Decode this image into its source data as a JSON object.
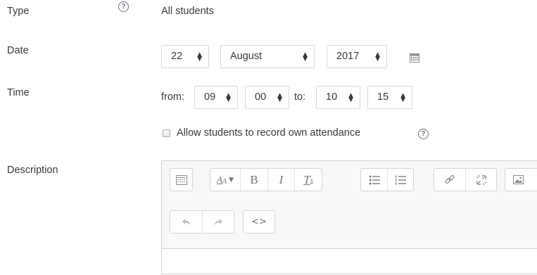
{
  "form": {
    "type": {
      "label": "Type",
      "value": "All students",
      "help_icon": "question-circle-icon"
    },
    "date": {
      "label": "Date",
      "day": "22",
      "month": "August",
      "year": "2017",
      "calendar_icon": "calendar-icon"
    },
    "time": {
      "label": "Time",
      "from_label": "from:",
      "from_hour": "09",
      "from_minute": "00",
      "to_label": "to:",
      "to_hour": "10",
      "to_minute": "15"
    },
    "self_record": {
      "label": "Allow students to record own attendance",
      "checked": false,
      "help_icon": "question-circle-icon"
    },
    "description": {
      "label": "Description",
      "toolbar": {
        "rows": [
          [
            {
              "name": "show-more-buttons",
              "icon": "keyboard-icon"
            },
            {
              "name": "font-style",
              "icon": "font-style-icon",
              "glyph": "A"
            },
            {
              "name": "bold",
              "icon": "bold-icon",
              "glyph": "B"
            },
            {
              "name": "italic",
              "icon": "italic-icon",
              "glyph": "I"
            },
            {
              "name": "clear-formatting",
              "icon": "clear-format-icon",
              "glyph": "T"
            },
            {
              "name": "unordered-list",
              "icon": "unordered-list-icon"
            },
            {
              "name": "ordered-list",
              "icon": "ordered-list-icon"
            },
            {
              "name": "link",
              "icon": "link-icon"
            },
            {
              "name": "unlink",
              "icon": "unlink-icon"
            },
            {
              "name": "image",
              "icon": "image-icon"
            }
          ],
          [
            {
              "name": "undo",
              "icon": "undo-icon"
            },
            {
              "name": "redo",
              "icon": "redo-icon"
            },
            {
              "name": "html",
              "icon": "code-icon",
              "glyph": "<>"
            }
          ]
        ]
      }
    }
  },
  "colors": {
    "text": "#373a3c",
    "border": "#d5d9dc",
    "icon": "#767676",
    "toolbar_bg": "#f8f8f8"
  }
}
